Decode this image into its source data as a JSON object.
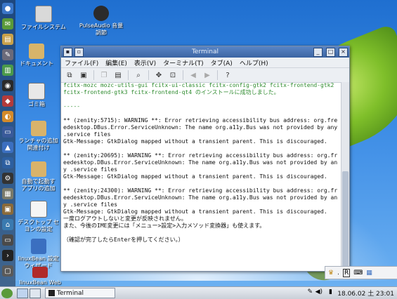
{
  "desktop": {
    "icons": [
      {
        "label": "ファイルシステム"
      },
      {
        "label": "PulseAudio 音量\n調節"
      },
      {
        "label": "ドキュメント"
      },
      {
        "label": "ゴミ箱"
      },
      {
        "label": "ランチャの追加\n関連付け"
      },
      {
        "label": "自動で起動す\nアプリの追加"
      },
      {
        "label": "デスクトップ セ\nヨンの設定"
      },
      {
        "label": "linuxBean 設定\nウィザード"
      },
      {
        "label": "linuxBean Web"
      }
    ]
  },
  "window": {
    "title": "Terminal",
    "menu": [
      "ファイル(F)",
      "編集(E)",
      "表示(V)",
      "ターミナル(T)",
      "タブ(A)",
      "ヘルプ(H)"
    ],
    "terminal_lines": [
      {
        "text": "fcitx-mozc mozc-utils-gui fcitx-ui-classic fcitx-config-gtk2 fcitx-frontend-gtk2 fcitx-frontend-gtk3 fcitx-frontend-qt4 のインストールに成功しました。",
        "color": "green"
      },
      {
        "text": "",
        "color": "normal"
      },
      {
        "text": "-----",
        "color": "green"
      },
      {
        "text": "",
        "color": "normal"
      },
      {
        "text": "** (zenity:5715): WARNING **: Error retrieving accessibility bus address: org.freedesktop.DBus.Error.ServiceUnknown: The name org.a11y.Bus was not provided by any .service files",
        "color": "normal"
      },
      {
        "text": "Gtk-Message: GtkDialog mapped without a transient parent. This is discouraged.",
        "color": "normal"
      },
      {
        "text": "",
        "color": "normal"
      },
      {
        "text": "** (zenity:20695): WARNING **: Error retrieving accessibility bus address: org.freedesktop.DBus.Error.ServiceUnknown: The name org.a11y.Bus was not provided by any .service files",
        "color": "normal"
      },
      {
        "text": "Gtk-Message: GtkDialog mapped without a transient parent. This is discouraged.",
        "color": "normal"
      },
      {
        "text": "",
        "color": "normal"
      },
      {
        "text": "** (zenity:24300): WARNING **: Error retrieving accessibility bus address: org.freedesktop.DBus.Error.ServiceUnknown: The name org.a11y.Bus was not provided by any .service files",
        "color": "normal"
      },
      {
        "text": "Gtk-Message: GtkDialog mapped without a transient parent. This is discouraged.",
        "color": "normal"
      },
      {
        "text": "一度ログアウトしないと変更が反映されません。",
        "color": "normal"
      },
      {
        "text": "また、今後のIME変更には「メニュー>設定>入力メソッド変換器」も使えます。",
        "color": "normal"
      },
      {
        "text": "",
        "color": "normal"
      },
      {
        "text": "（確認が完了したらEnterを押してください。）",
        "color": "normal"
      }
    ]
  },
  "taskbar": {
    "task_label": "Terminal",
    "clock": "18.06.02 土 23:01"
  },
  "colors": {
    "titlebar": "#3b64a3",
    "terminal_green": "#2e8b2e"
  }
}
